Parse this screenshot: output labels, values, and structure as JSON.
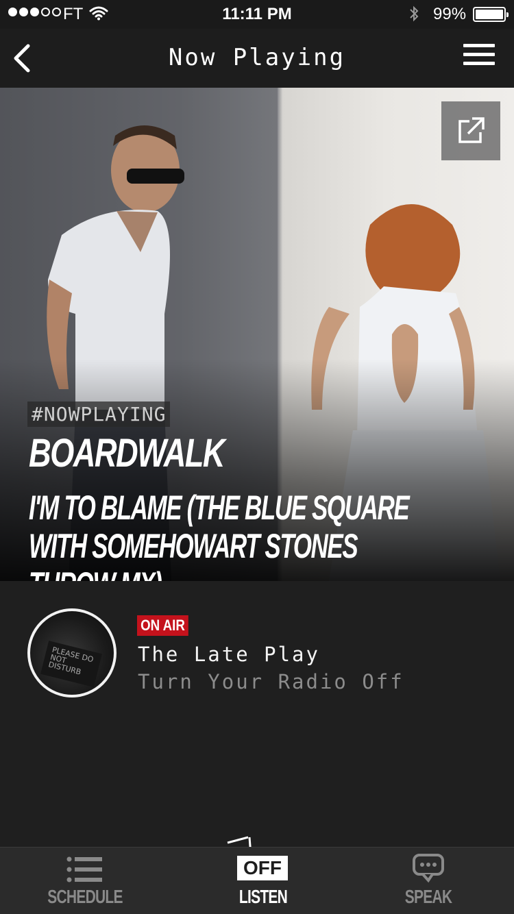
{
  "status_bar": {
    "carrier": "FT",
    "time": "11:11 PM",
    "battery": "99%"
  },
  "nav": {
    "title": "Now Playing",
    "back_icon": "chevron-left-icon",
    "menu_icon": "hamburger-menu-icon"
  },
  "now_playing": {
    "hashtag": "#NOWPLAYING",
    "artist": "BOARDWALK",
    "track": "I'M TO BLAME (THE BLUE SQUARE WITH SOMEHOWART STONES THROW MX)",
    "share_icon": "external-link-icon"
  },
  "on_air": {
    "badge": "ON AIR",
    "show_name": "The Late Play",
    "subtitle": "Turn Your Radio Off",
    "avatar_text": "PLEASE DO NOT DISTURB"
  },
  "tabs": [
    {
      "label": "SCHEDULE",
      "icon": "list-icon",
      "active": false
    },
    {
      "label": "LISTEN",
      "icon": "radio-icon",
      "badge": "OFF",
      "active": true
    },
    {
      "label": "SPEAK",
      "icon": "speech-bubble-icon",
      "active": false
    }
  ],
  "colors": {
    "background": "#1f1f1f",
    "on_air_red": "#c4121c",
    "tab_inactive": "#8a8a8a",
    "tab_active": "#ffffff"
  }
}
